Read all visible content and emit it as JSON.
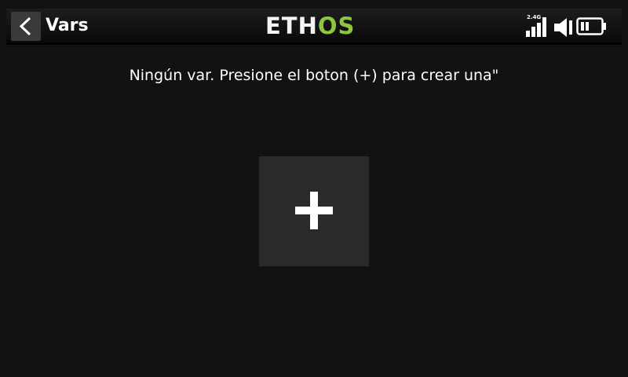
{
  "header": {
    "title": "Vars",
    "logo": {
      "part_a": "ETH",
      "part_b": "OS"
    },
    "status": {
      "radio_band": "2.4G",
      "signal_icon": "signal-bars-icon",
      "volume_icon": "speaker-icon",
      "battery_icon": "battery-icon"
    },
    "back_icon": "chevron-left-icon"
  },
  "main": {
    "empty_message": "Ningún var. Presione el boton (+) para crear una\"",
    "add_icon": "plus-icon"
  },
  "colors": {
    "background": "#121212",
    "accent_green": "#8dc63f",
    "button": "#2a2a2a"
  }
}
